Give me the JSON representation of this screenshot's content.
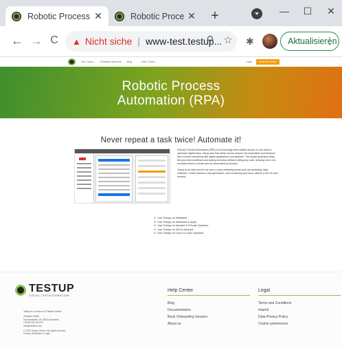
{
  "browser": {
    "tabs": [
      {
        "title": "Robotic Process Au",
        "active": true
      },
      {
        "title": "Robotic Process Au",
        "active": false
      }
    ],
    "new_tab_symbol": "+",
    "window_controls": {
      "minimize": "—",
      "maximize": "☐",
      "close": "✕"
    },
    "toolbar": {
      "back": "←",
      "forward": "→",
      "reload": "C",
      "security_warning": "Nicht siche",
      "separator": "|",
      "url": "www-test.testup...",
      "zoom_icon": "⚲",
      "bookmark_icon": "☆",
      "extensions_icon": "✱",
      "update_button": "Aktualisieren",
      "menu_icon": "⋮"
    }
  },
  "site": {
    "nav": {
      "items": [
        "Use Cases ⌄",
        "Preisliste Übersicht",
        "Blog",
        "Help Center ⌄"
      ],
      "login": "Login",
      "trial_button": "Kostenlos Testen"
    },
    "hero": {
      "title_line1": "Robotic Process",
      "title_line2": "Automation (RPA)"
    },
    "section_heading": "Never repeat a task twice! Automate it!",
    "description": [
      "Robotic Process Automation (RPA) is a technology that enables anyone to use tools to automate digital tasks. Using bots that mimic human actions, the automation tool behaves like a human interacting with digital applications and systems. The simple graphical editor lets you build workflows and testing scenarios without writing any code, allowing even non-technical users to create and run automated processes.",
      "Testup is an ideal tool for the use in many marketing areas such as marketing, data collection, online research, lead generation, web monitoring and more, without a line of code needed."
    ],
    "features": [
      "Use Testup on Websites",
      "Use Testup on Windows & Apps",
      "Use Testup on Intranet & Private Systems",
      "Use Testup on iOS & Android",
      "Use Testup on Linux & Linux Systems"
    ],
    "footer": {
      "brand_name": "TESTUP",
      "brand_tagline": "VISUAL TESTAUTOMATION",
      "contact": [
        "Testup is a service of Thetaris GmbH",
        "Thetaris GmbH",
        "Sonnenstraße 19, 80331 München",
        "+49 89 123 45 678",
        "info@thetaris.com",
        "© 2023 Testup GmbH. All rights reserved.",
        "Privacy Statement / Legal"
      ],
      "help_center": {
        "title": "Help Center",
        "links": [
          "Blog",
          "Documentation",
          "Book Onboarding Session",
          "About us"
        ]
      },
      "legal": {
        "title": "Legal",
        "links": [
          "Terms and Conditions",
          "Imprint",
          "Data Privacy Policy",
          "Cookie preferences"
        ]
      }
    }
  },
  "colors": {
    "hero_green": "#3f8f2e",
    "hero_orange": "#e07012",
    "accent_green": "#8bc34a",
    "warning_red": "#d93025",
    "update_green": "#137333",
    "trial_orange": "#f39c12"
  }
}
